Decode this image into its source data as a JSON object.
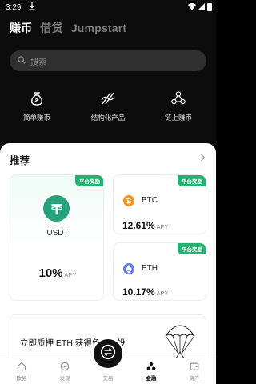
{
  "status": {
    "time": "3:29"
  },
  "tabs": [
    {
      "label": "赚币",
      "active": true
    },
    {
      "label": "借贷",
      "active": false
    },
    {
      "label": "Jumpstart",
      "active": false
    }
  ],
  "search": {
    "placeholder": "搜索"
  },
  "quick_actions": [
    {
      "label": "简单赚币",
      "icon": "money-bag-icon"
    },
    {
      "label": "结构化产品",
      "icon": "structured-product-icon"
    },
    {
      "label": "链上赚币",
      "icon": "onchain-nodes-icon"
    }
  ],
  "recommend": {
    "title": "推荐",
    "cards": [
      {
        "name": "USDT",
        "badge": "平台奖励",
        "apy": "10%",
        "apy_label": "APY",
        "coin_color": "#26a17b",
        "icon": "tether-icon"
      },
      {
        "name": "BTC",
        "badge": "平台奖励",
        "apy": "12.61%",
        "apy_label": "APY",
        "coin_color": "#f7931a",
        "icon": "bitcoin-icon"
      },
      {
        "name": "ETH",
        "badge": "平台奖励",
        "apy": "10.17%",
        "apy_label": "APY",
        "coin_color": "#627eea",
        "icon": "ethereum-icon"
      }
    ]
  },
  "promo": {
    "text": "立即质押 ETH 获得免费空投"
  },
  "nav": [
    {
      "label": "欧易",
      "icon": "home-icon",
      "active": false
    },
    {
      "label": "发现",
      "icon": "discover-icon",
      "active": false
    },
    {
      "label": "交易",
      "icon": "trade-swap-icon",
      "active": false
    },
    {
      "label": "金融",
      "icon": "finance-icon",
      "active": true
    },
    {
      "label": "资产",
      "icon": "wallet-icon",
      "active": false
    }
  ],
  "colors": {
    "accent_green": "#23b26f",
    "dark_bg": "#0c0c0c"
  }
}
